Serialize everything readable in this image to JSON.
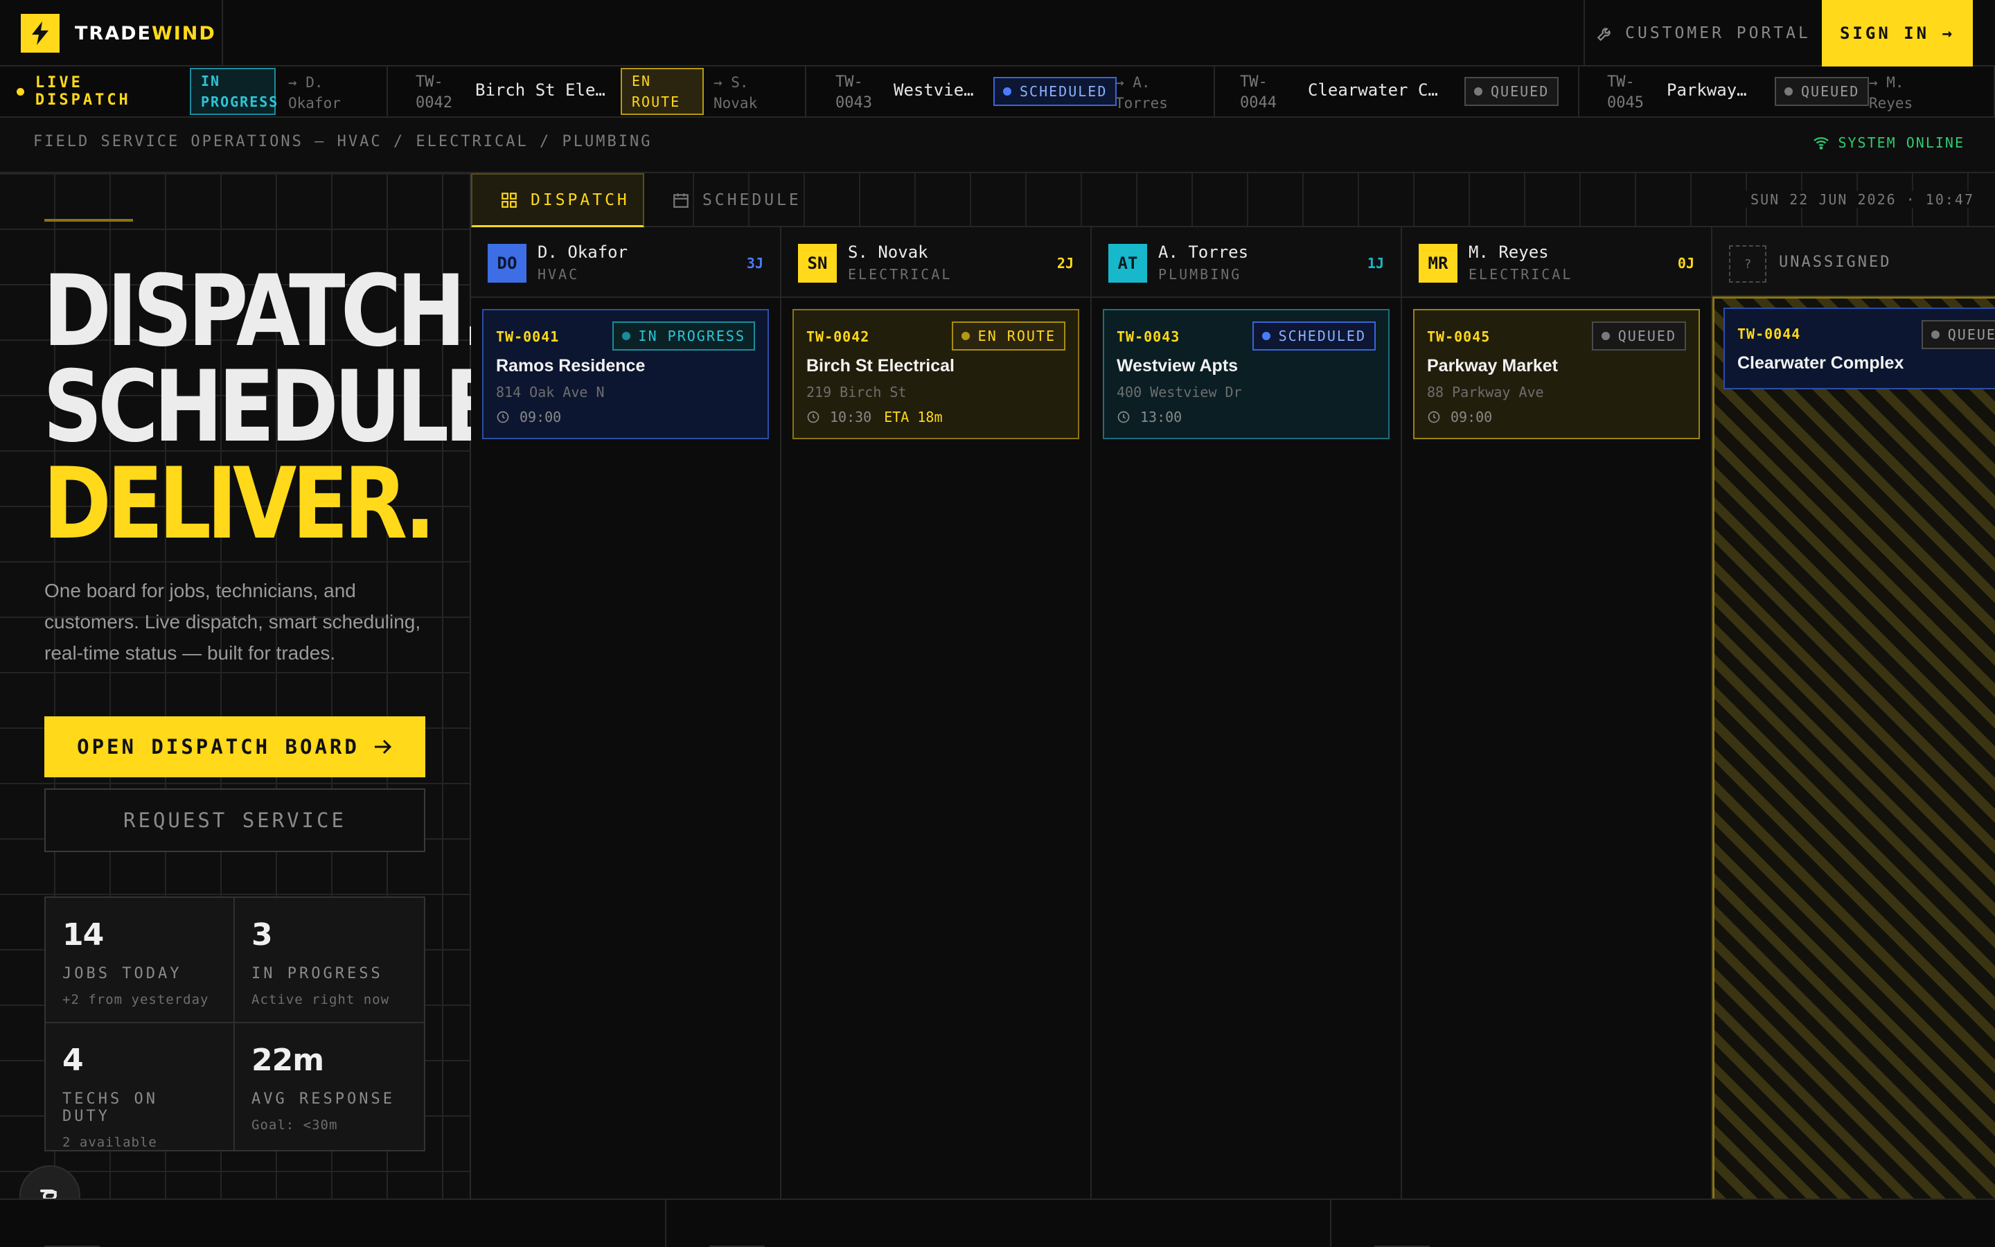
{
  "header": {
    "brand": {
      "part1": "TRADE",
      "part2": "WIND"
    },
    "portal_label": "CUSTOMER PORTAL",
    "signin_label": "SIGN IN →"
  },
  "ticker": {
    "live_label": "LIVE DISPATCH",
    "items": [
      {
        "id": "",
        "name": "",
        "status": "IN PROGRESS",
        "status_l1": "IN",
        "status_l2": "PROGRESS",
        "tech_l1": "→ D.",
        "tech_l2": "Okafor"
      },
      {
        "id_l1": "TW-",
        "id_l2": "0042",
        "name": "Birch St Elec…",
        "status_l1": "EN",
        "status_l2": "ROUTE",
        "tech_l1": "→ S.",
        "tech_l2": "Novak"
      },
      {
        "id_l1": "TW-",
        "id_l2": "0043",
        "name": "Westview…",
        "status": "SCHEDULED",
        "tech_l1": "→ A.",
        "tech_l2": "Torres"
      },
      {
        "id_l1": "TW-",
        "id_l2": "0044",
        "name": "Clearwater Com…",
        "status": "QUEUED"
      },
      {
        "id_l1": "TW-",
        "id_l2": "0045",
        "name": "Parkway M…",
        "status": "QUEUED",
        "tech_l1": "→ M.",
        "tech_l2": "Reyes"
      }
    ]
  },
  "subheader": {
    "text": "FIELD SERVICE OPERATIONS — HVAC / ELECTRICAL / PLUMBING",
    "status": "SYSTEM ONLINE"
  },
  "hero": {
    "line1": "DISPATCH.",
    "line2": "SCHEDULE.",
    "line3": "DELIVER.",
    "description": "One board for jobs, technicians, and customers. Live dispatch, smart scheduling, real-time status — built for trades.",
    "primary_cta": "OPEN DISPATCH BOARD",
    "secondary_cta": "REQUEST SERVICE",
    "stats": [
      {
        "value": "14",
        "label": "JOBS TODAY",
        "sub": "+2 from yesterday"
      },
      {
        "value": "3",
        "label": "IN PROGRESS",
        "sub": "Active right now"
      },
      {
        "value": "4",
        "label": "TECHS ON DUTY",
        "sub": "2 available"
      },
      {
        "value": "22m",
        "label": "AVG RESPONSE",
        "sub": "Goal: <30m"
      }
    ]
  },
  "board": {
    "tabs": [
      {
        "label": "DISPATCH",
        "active": true
      },
      {
        "label": "SCHEDULE",
        "active": false
      }
    ],
    "clock": "SUN 22 JUN 2026 · 10:47",
    "columns": [
      {
        "initials": "DO",
        "name": "D. Okafor",
        "role": "HVAC",
        "count": "3J",
        "color": "#3d6ee6",
        "card": {
          "id": "TW-0041",
          "status": "IN PROGRESS",
          "title": "Ramos Residence",
          "address": "814 Oak Ave N",
          "time": "09:00",
          "eta": ""
        }
      },
      {
        "initials": "SN",
        "name": "S. Novak",
        "role": "ELECTRICAL",
        "count": "2J",
        "color": "#ffd91a",
        "card": {
          "id": "TW-0042",
          "status": "EN ROUTE",
          "title": "Birch St Electrical",
          "address": "219 Birch St",
          "time": "10:30",
          "eta": "ETA 18m"
        }
      },
      {
        "initials": "AT",
        "name": "A. Torres",
        "role": "PLUMBING",
        "count": "1J",
        "color": "#18b8cc",
        "card": {
          "id": "TW-0043",
          "status": "SCHEDULED",
          "title": "Westview Apts",
          "address": "400 Westview Dr",
          "time": "13:00",
          "eta": ""
        }
      },
      {
        "initials": "MR",
        "name": "M. Reyes",
        "role": "ELECTRICAL",
        "count": "0J",
        "color": "#ffd91a",
        "card": {
          "id": "TW-0045",
          "status": "QUEUED",
          "title": "Parkway Market",
          "address": "88 Parkway Ave",
          "time": "09:00",
          "eta": ""
        }
      }
    ],
    "unassigned": {
      "box": "?",
      "label": "UNASSIGNED",
      "card": {
        "id": "TW-0044",
        "status": "QUEUED",
        "title": "Clearwater Complex"
      }
    }
  },
  "colors": {
    "accent": "#ffd91a",
    "in_progress": "#2ec4d6",
    "scheduled": "#3a64d8",
    "online": "#2ecc71"
  }
}
